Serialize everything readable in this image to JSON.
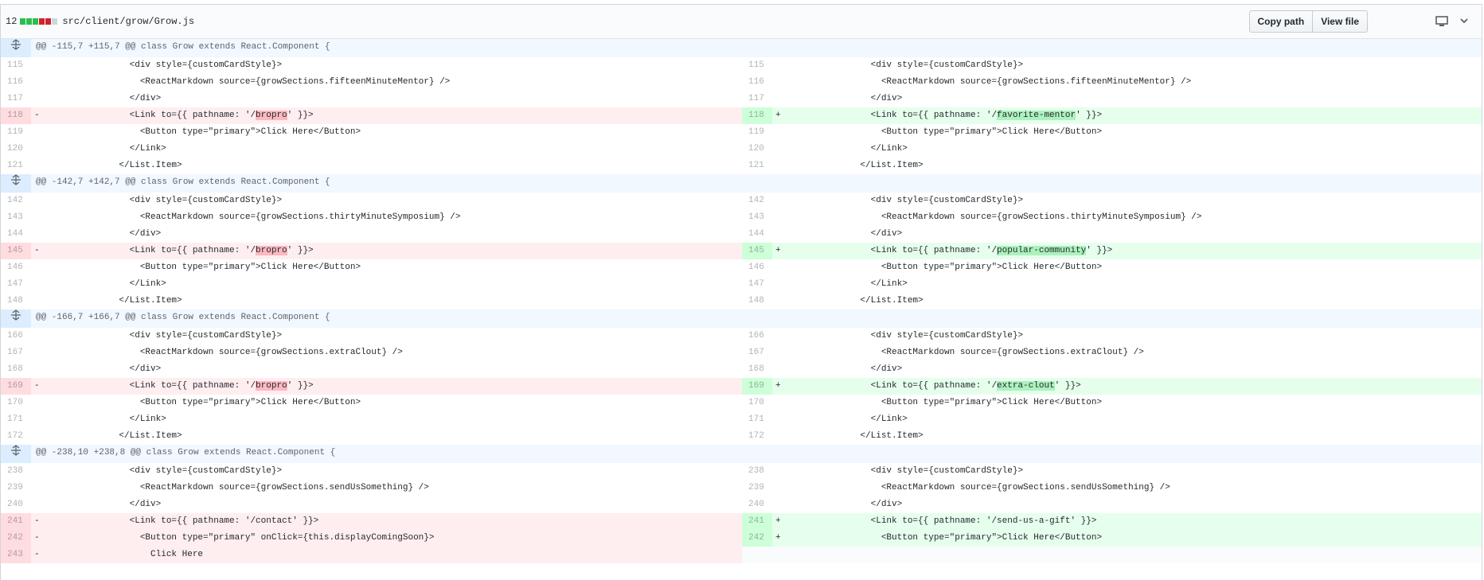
{
  "file": {
    "change_count": "12",
    "path": "src/client/grow/Grow.js",
    "diffstat": [
      "#2cbe4e",
      "#2cbe4e",
      "#2cbe4e",
      "#cb2431",
      "#cb2431",
      "#d1d5da"
    ]
  },
  "actions": {
    "copy_path": "Copy path",
    "view_file": "View file",
    "display_icon": "desktop-icon",
    "menu_icon": "chevron-down-icon"
  },
  "hunks": [
    {
      "header": "@@ -115,7 +115,7 @@ class Grow extends React.Component {",
      "expand_icon": "unfold-icon",
      "rows": [
        {
          "type": "ctx",
          "l": "115",
          "r": "115",
          "code": "                <div style={customCardStyle}>"
        },
        {
          "type": "ctx",
          "l": "116",
          "r": "116",
          "code": "                  <ReactMarkdown source={growSections.fifteenMinuteMentor} />"
        },
        {
          "type": "ctx",
          "l": "117",
          "r": "117",
          "code": "                </div>"
        },
        {
          "type": "chg",
          "l": "118",
          "r": "118",
          "lpre": "                <Link to={{ pathname: '/",
          "lhi": "bropro",
          "lpost": "' }}>",
          "rpre": "                <Link to={{ pathname: '/",
          "rhi": "favorite-mentor",
          "rpost": "' }}>"
        },
        {
          "type": "ctx",
          "l": "119",
          "r": "119",
          "code": "                  <Button type=\"primary\">Click Here</Button>"
        },
        {
          "type": "ctx",
          "l": "120",
          "r": "120",
          "code": "                </Link>"
        },
        {
          "type": "ctx",
          "l": "121",
          "r": "121",
          "code": "              </List.Item>"
        }
      ]
    },
    {
      "header": "@@ -142,7 +142,7 @@ class Grow extends React.Component {",
      "expand_icon": "unfold-icon",
      "rows": [
        {
          "type": "ctx",
          "l": "142",
          "r": "142",
          "code": "                <div style={customCardStyle}>"
        },
        {
          "type": "ctx",
          "l": "143",
          "r": "143",
          "code": "                  <ReactMarkdown source={growSections.thirtyMinuteSymposium} />"
        },
        {
          "type": "ctx",
          "l": "144",
          "r": "144",
          "code": "                </div>"
        },
        {
          "type": "chg",
          "l": "145",
          "r": "145",
          "lpre": "                <Link to={{ pathname: '/",
          "lhi": "bropro",
          "lpost": "' }}>",
          "rpre": "                <Link to={{ pathname: '/",
          "rhi": "popular-community",
          "rpost": "' }}>"
        },
        {
          "type": "ctx",
          "l": "146",
          "r": "146",
          "code": "                  <Button type=\"primary\">Click Here</Button>"
        },
        {
          "type": "ctx",
          "l": "147",
          "r": "147",
          "code": "                </Link>"
        },
        {
          "type": "ctx",
          "l": "148",
          "r": "148",
          "code": "              </List.Item>"
        }
      ]
    },
    {
      "header": "@@ -166,7 +166,7 @@ class Grow extends React.Component {",
      "expand_icon": "unfold-icon",
      "rows": [
        {
          "type": "ctx",
          "l": "166",
          "r": "166",
          "code": "                <div style={customCardStyle}>"
        },
        {
          "type": "ctx",
          "l": "167",
          "r": "167",
          "code": "                  <ReactMarkdown source={growSections.extraClout} />"
        },
        {
          "type": "ctx",
          "l": "168",
          "r": "168",
          "code": "                </div>"
        },
        {
          "type": "chg",
          "l": "169",
          "r": "169",
          "lpre": "                <Link to={{ pathname: '/",
          "lhi": "bropro",
          "lpost": "' }}>",
          "rpre": "                <Link to={{ pathname: '/",
          "rhi": "extra-clout",
          "rpost": "' }}>"
        },
        {
          "type": "ctx",
          "l": "170",
          "r": "170",
          "code": "                  <Button type=\"primary\">Click Here</Button>"
        },
        {
          "type": "ctx",
          "l": "171",
          "r": "171",
          "code": "                </Link>"
        },
        {
          "type": "ctx",
          "l": "172",
          "r": "172",
          "code": "              </List.Item>"
        }
      ]
    },
    {
      "header": "@@ -238,10 +238,8 @@ class Grow extends React.Component {",
      "expand_icon": "unfold-icon",
      "rows": [
        {
          "type": "ctx",
          "l": "238",
          "r": "238",
          "code": "                <div style={customCardStyle}>"
        },
        {
          "type": "ctx",
          "l": "239",
          "r": "239",
          "code": "                  <ReactMarkdown source={growSections.sendUsSomething} />"
        },
        {
          "type": "ctx",
          "l": "240",
          "r": "240",
          "code": "                </div>"
        },
        {
          "type": "chg",
          "l": "241",
          "r": "241",
          "lpre": "                <Link to={{ pathname: '/contact' }}>",
          "lhi": "",
          "lpost": "",
          "rpre": "                <Link to={{ pathname: '/send-us-a-gift' }}>",
          "rhi": "",
          "rpost": ""
        },
        {
          "type": "chg",
          "l": "242",
          "r": "242",
          "lpre": "                  <Button type=\"primary\" onClick={this.displayComingSoon}>",
          "lhi": "",
          "lpost": "",
          "rpre": "                  <Button type=\"primary\">Click Here</Button>",
          "rhi": "",
          "rpost": ""
        },
        {
          "type": "del",
          "l": "243",
          "r": "",
          "code": "                    Click Here"
        }
      ]
    }
  ]
}
